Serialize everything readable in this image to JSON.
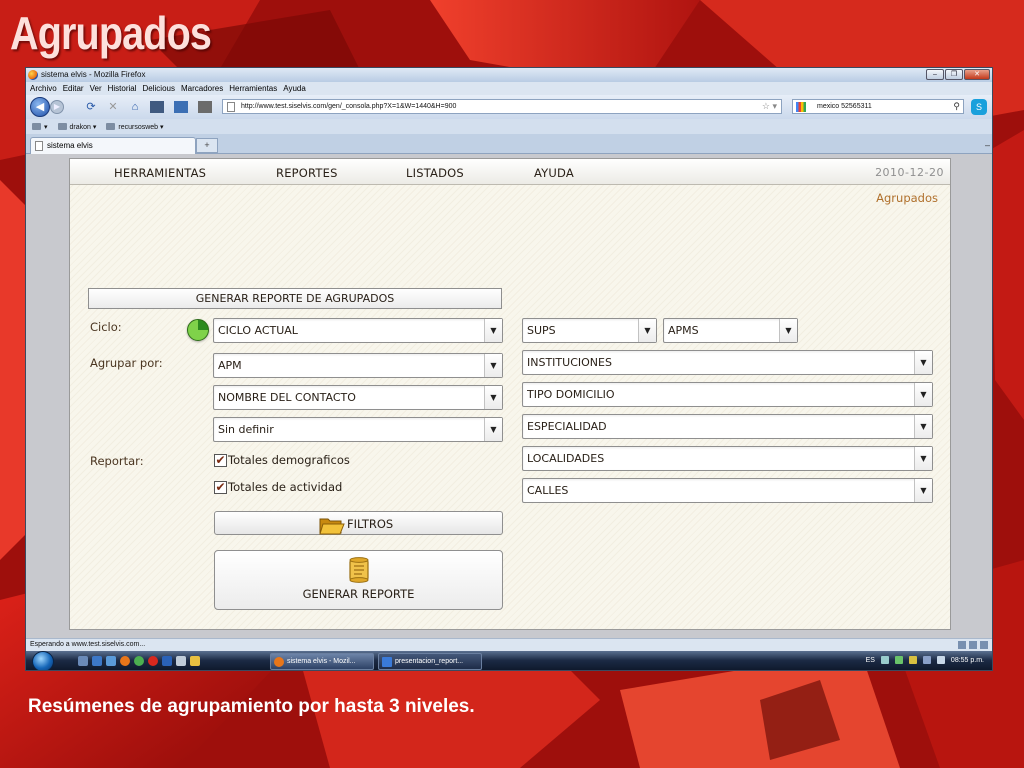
{
  "slide": {
    "title": "Agrupados",
    "caption": "Resúmenes de agrupamiento por hasta 3 niveles."
  },
  "browser": {
    "window_title": "sistema elvis - Mozilla Firefox",
    "menu": [
      "Archivo",
      "Editar",
      "Ver",
      "Historial",
      "Delicious",
      "Marcadores",
      "Herramientas",
      "Ayuda"
    ],
    "url": "http://www.test.siselvis.com/gen/_consola.php?X=1&W=1440&H=900",
    "search_value": "mexico 52565311",
    "bookmarks": [
      "drakon ▾",
      "recursosweb ▾"
    ],
    "tab_title": "sistema elvis",
    "new_tab": "+",
    "status_text": "Esperando a www.test.siselvis.com...",
    "window_buttons": [
      "–",
      "❐",
      "✕"
    ]
  },
  "app": {
    "menu": [
      "HERRAMIENTAS",
      "REPORTES",
      "LISTADOS",
      "AYUDA"
    ],
    "date": "2010-12-20",
    "breadcrumb": "Agrupados",
    "section_title": "GENERAR REPORTE DE AGRUPADOS",
    "labels": {
      "ciclo": "Ciclo:",
      "agrupar": "Agrupar por:",
      "reportar": "Reportar:"
    },
    "ciclo_value": "CICLO ACTUAL",
    "agrupar_values": [
      "APM",
      "NOMBRE DEL CONTACTO",
      "Sin definir"
    ],
    "checkboxes": [
      {
        "label": "Totales demograficos",
        "checked": true
      },
      {
        "label": "Totales de actividad",
        "checked": true
      }
    ],
    "right_selects": {
      "sups": "SUPS",
      "apms": "APMS",
      "list": [
        "INSTITUCIONES",
        "TIPO DOMICILIO",
        "ESPECIALIDAD",
        "LOCALIDADES",
        "CALLES"
      ]
    },
    "filters_button": "FILTROS",
    "generate_button": "GENERAR REPORTE"
  },
  "taskbar": {
    "tasks": [
      "sistema elvis - Mozil...",
      "presentacion_report..."
    ],
    "lang": "ES",
    "clock": "08:55 p.m."
  },
  "icons": {
    "checkmark": "✔",
    "dropdown": "▼",
    "back": "◀",
    "forward": "▶"
  },
  "colors": {
    "page_bg": "#f8f6ec",
    "text_brown": "#4a3520",
    "breadcrumb": "#b0702c",
    "cycle_green": "#7fd24a"
  }
}
